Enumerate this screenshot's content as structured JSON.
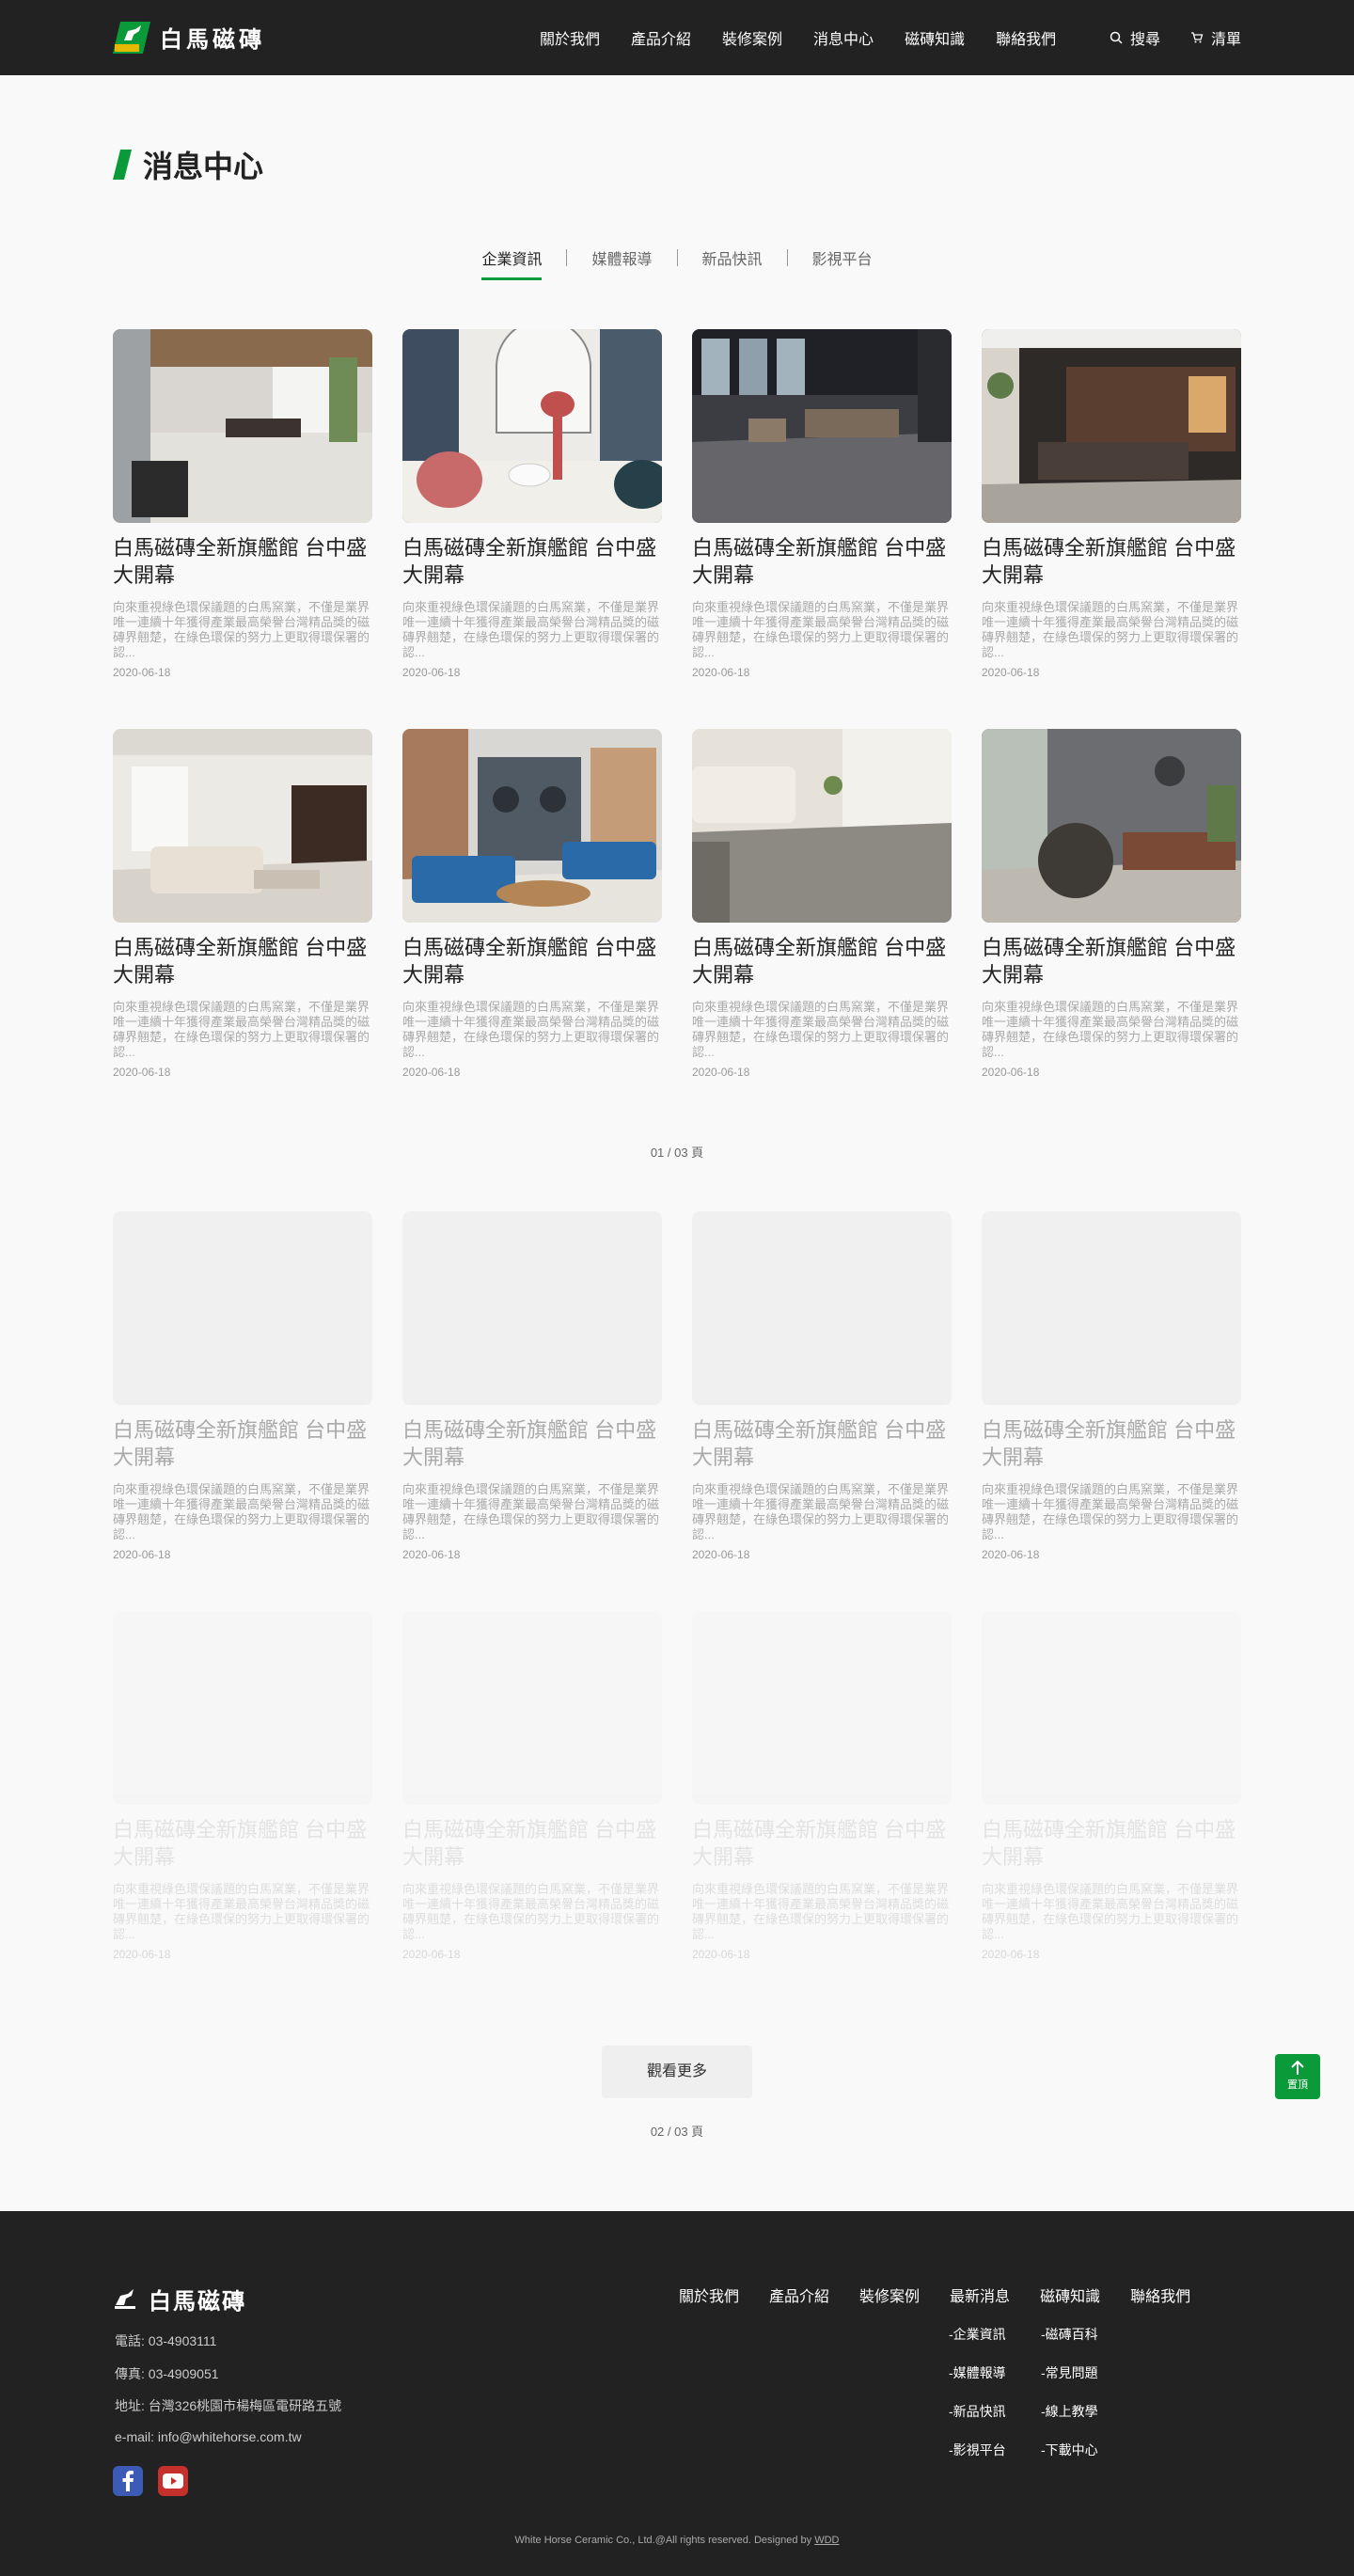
{
  "header": {
    "logo_text": "白馬磁磚",
    "nav": [
      "關於我們",
      "產品介紹",
      "裝修案例",
      "消息中心",
      "磁磚知識",
      "聯絡我們"
    ],
    "search_label": "搜尋",
    "cart_label": "清單"
  },
  "page": {
    "title": "消息中心",
    "tabs": [
      "企業資訊",
      "媒體報導",
      "新品快訊",
      "影視平台"
    ]
  },
  "article": {
    "title": "白馬磁磚全新旗艦館 台中盛大開幕",
    "desc": "向來重視綠色環保議題的白馬窯業，不僅是業界唯一連續十年獲得產業最高榮譽台灣精品獎的磁磚界翹楚，在綠色環保的努力上更取得環保署的認...",
    "date": "2020-06-18"
  },
  "pager1": "01 / 03 頁",
  "pager2": "02 / 03 頁",
  "more_label": "觀看更多",
  "top_label": "置頂",
  "footer": {
    "logo_text": "白馬磁磚",
    "phone": "電話:  03-4903111",
    "fax": "傳真:  03-4909051",
    "address": "地址:  台灣326桃園市楊梅區電研路五號",
    "email": "e-mail:  info@whitehorse.com.tw",
    "nav": [
      "關於我們",
      "產品介紹",
      "裝修案例",
      "最新消息",
      "磁磚知識",
      "聯絡我們"
    ],
    "news_sub": [
      "-企業資訊",
      "-媒體報導",
      "-新品快訊",
      "-影視平台"
    ],
    "knowledge_sub": [
      "-磁磚百科",
      "-常見問題",
      "-線上教學",
      "-下載中心"
    ],
    "copyright": "White Horse Ceramic Co., Ltd.@All rights reserved. Designed by ",
    "designer": "WDD"
  },
  "colors": {
    "header_bg": "#222222",
    "accent_green": "#0a9a3a",
    "page_bg": "#f9f9f9"
  }
}
